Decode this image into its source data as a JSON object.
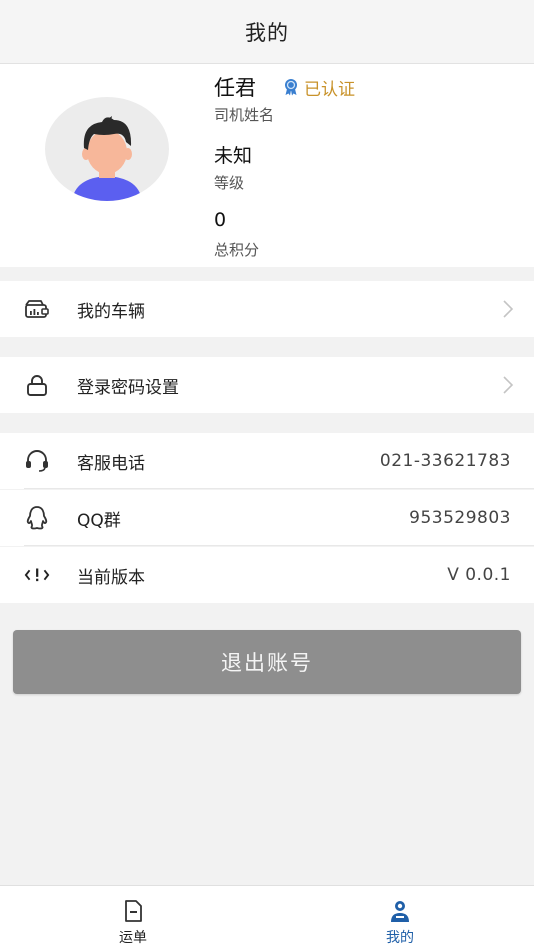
{
  "header": {
    "title": "我的"
  },
  "profile": {
    "name": "任君",
    "verified_label": "已认证",
    "name_caption": "司机姓名",
    "level": "未知",
    "level_caption": "等级",
    "points": "0",
    "points_caption": "总积分"
  },
  "menu": {
    "vehicle": {
      "label": "我的车辆",
      "icon": "vehicle-icon"
    },
    "password": {
      "label": "登录密码设置",
      "icon": "lock-icon"
    },
    "service_phone": {
      "label": "客服电话",
      "value": "021-33621783",
      "icon": "headset-icon"
    },
    "qq_group": {
      "label": "QQ群",
      "value": "953529803",
      "icon": "qq-icon"
    },
    "version": {
      "label": "当前版本",
      "value": "V 0.0.1",
      "icon": "code-icon"
    }
  },
  "logout": {
    "label": "退出账号"
  },
  "tabbar": {
    "tabs": [
      {
        "label": "运单",
        "icon": "document-icon",
        "active": false
      },
      {
        "label": "我的",
        "icon": "user-icon",
        "active": true
      }
    ]
  },
  "colors": {
    "active_tab": "#1f5fa8",
    "verified": "#c8922a",
    "logout_bg": "#8e8e8e"
  }
}
